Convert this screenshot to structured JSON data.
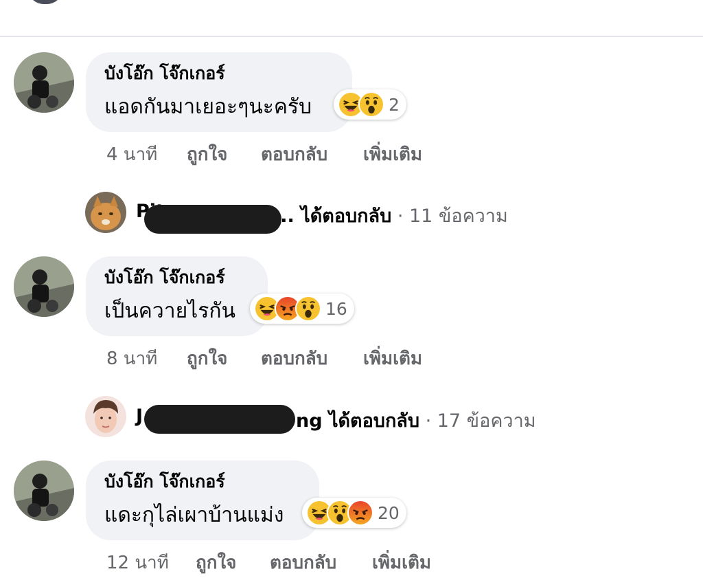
{
  "comments": [
    {
      "author": "บังโอ๊ก โจ๊กเกอร์",
      "text": "แอดกันมาเยอะๆนะครับ",
      "reactions": [
        "haha-icon",
        "wow-icon"
      ],
      "reaction_count": "2",
      "time": "4 นาที",
      "like": "ถูกใจ",
      "reply": "ตอบกลับ",
      "more": "เพิ่มเติม",
      "reply_summary": {
        "author_visible": "Pit…",
        "tail": "... ได้ตอบกลับ",
        "count": "· 11 ข้อความ"
      }
    },
    {
      "author": "บังโอ๊ก โจ๊กเกอร์",
      "text": "เป็นควายไรกัน",
      "reactions": [
        "haha-icon",
        "angry-icon",
        "wow-icon"
      ],
      "reaction_count": "16",
      "time": "8 นาที",
      "like": "ถูกใจ",
      "reply": "ตอบกลับ",
      "more": "เพิ่มเติม",
      "reply_summary": {
        "author_visible": "J",
        "tail": "ng ได้ตอบกลับ",
        "count": "· 17 ข้อความ"
      }
    },
    {
      "author": "บังโอ๊ก โจ๊กเกอร์",
      "text": "แดะกุไล่เผาบ้านแม่ง",
      "reactions": [
        "haha-icon",
        "wow-icon",
        "angry-icon"
      ],
      "reaction_count": "20",
      "time": "12 นาที",
      "like": "ถูกใจ",
      "reply": "ตอบกลับ",
      "more": "เพิ่มเติม"
    }
  ]
}
